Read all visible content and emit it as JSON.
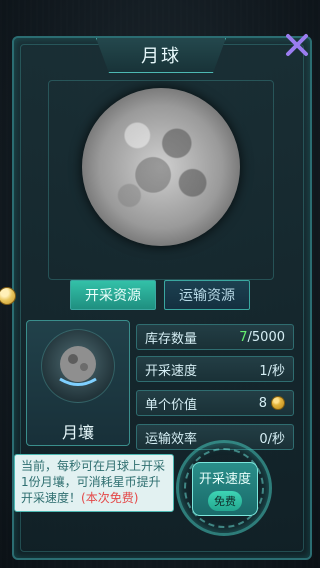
{
  "dialog": {
    "title": "月球",
    "tabs": [
      {
        "label": "开采资源",
        "active": true
      },
      {
        "label": "运输资源",
        "active": false
      }
    ],
    "item": {
      "name": "月壤"
    },
    "stats": [
      {
        "label": "库存数量",
        "current": "7",
        "max": "5000"
      },
      {
        "label": "开采速度",
        "value": "1/秒"
      },
      {
        "label": "单个价值",
        "value": "8"
      },
      {
        "label": "运输效率",
        "value": "0/秒"
      }
    ],
    "info": {
      "text": "当前，每秒可在月球上开采1份月壤，可消耗星币提升开采速度！",
      "highlight": "(本次免费)"
    },
    "speed_button": {
      "title": "开采速度",
      "badge": "免费"
    }
  },
  "colors": {
    "accent": "#33c1a8",
    "border": "#2b6d72",
    "green_value": "#66f070",
    "highlight_red": "#e44848"
  },
  "icons": {
    "close": "close-x-icon",
    "coin": "coin-icon",
    "item": "moon-soil-icon"
  }
}
